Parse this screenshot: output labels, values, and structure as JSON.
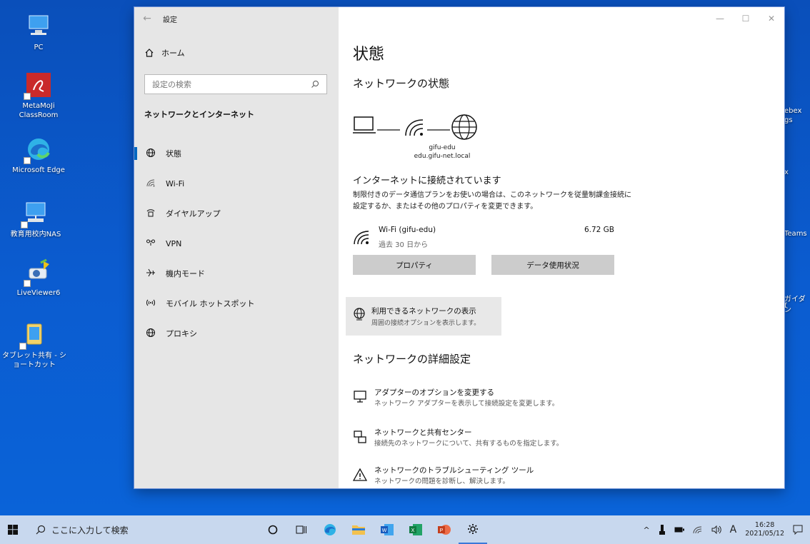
{
  "desktop": {
    "icons": [
      {
        "label": "PC"
      },
      {
        "label": "MetaMoJi ClassRoom"
      },
      {
        "label": "Microsoft Edge"
      },
      {
        "label": "教育用校内NAS"
      },
      {
        "label": "LiveViewer6"
      },
      {
        "label": "タブレット共有 - ショートカット"
      }
    ],
    "right_fragments": [
      "ebex",
      "gs",
      "x",
      "Teams",
      "ガイダン",
      "f"
    ]
  },
  "window": {
    "title": "設定",
    "home_label": "ホーム",
    "search_placeholder": "設定の検索",
    "section_title": "ネットワークとインターネット",
    "nav": [
      {
        "label": "状態",
        "icon": "globe-icon",
        "active": true
      },
      {
        "label": "Wi-Fi",
        "icon": "wifi-icon"
      },
      {
        "label": "ダイヤルアップ",
        "icon": "dialup-icon"
      },
      {
        "label": "VPN",
        "icon": "vpn-icon"
      },
      {
        "label": "機内モード",
        "icon": "airplane-icon"
      },
      {
        "label": "モバイル ホットスポット",
        "icon": "hotspot-icon"
      },
      {
        "label": "プロキシ",
        "icon": "globe-icon"
      }
    ]
  },
  "main": {
    "page_title": "状態",
    "network_status_heading": "ネットワークの状態",
    "network_name": "gifu-edu",
    "network_domain": "edu.gifu-net.local",
    "connected_title": "インターネットに接続されています",
    "connected_desc": "制限付きのデータ通信プランをお使いの場合は、このネットワークを従量制課金接続に設定するか、またはその他のプロパティを変更できます。",
    "usage": {
      "name": "Wi-Fi (gifu-edu)",
      "sub": "過去 30 日から",
      "amount": "6.72 GB"
    },
    "buttons": {
      "properties": "プロパティ",
      "data_usage": "データ使用状況"
    },
    "available": {
      "title": "利用できるネットワークの表示",
      "sub": "周囲の接続オプションを表示します。"
    },
    "advanced_heading": "ネットワークの詳細設定",
    "links": [
      {
        "title": "アダプターのオプションを変更する",
        "sub": "ネットワーク アダプターを表示して接続設定を変更します。"
      },
      {
        "title": "ネットワークと共有センター",
        "sub": "接続先のネットワークについて、共有するものを指定します。"
      },
      {
        "title": "ネットワークのトラブルシューティング ツール",
        "sub": "ネットワークの問題を診断し、解決します。"
      }
    ]
  },
  "taskbar": {
    "search_placeholder": "ここに入力して検索",
    "ime": "A",
    "time": "16:28",
    "date": "2021/05/12"
  }
}
